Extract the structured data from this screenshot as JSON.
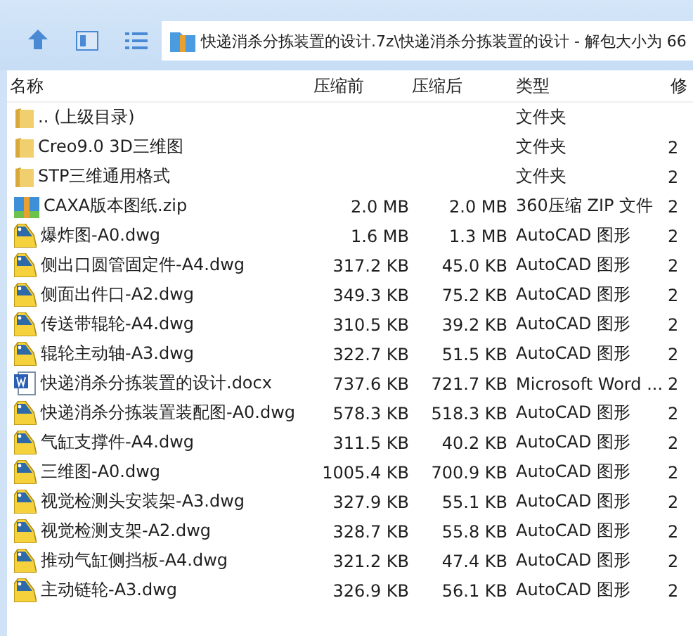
{
  "address": "快递消杀分拣装置的设计.7z\\快递消杀分拣装置的设计 - 解包大小为 66",
  "columns": [
    {
      "label": "名称"
    },
    {
      "label": "压缩前"
    },
    {
      "label": "压缩后"
    },
    {
      "label": "类型"
    },
    {
      "label": "修"
    }
  ],
  "rows": [
    {
      "kind": "folder",
      "name": ".. (上级目录)",
      "size": "",
      "packed": "",
      "type": "文件夹",
      "modified": ""
    },
    {
      "kind": "folder",
      "name": "Creo9.0 3D三维图",
      "size": "",
      "packed": "",
      "type": "文件夹",
      "modified": "2"
    },
    {
      "kind": "folder",
      "name": "STP三维通用格式",
      "size": "",
      "packed": "",
      "type": "文件夹",
      "modified": "2"
    },
    {
      "kind": "zip",
      "name": "CAXA版本图纸.zip",
      "size": "2.0 MB",
      "packed": "2.0 MB",
      "type": "360压缩 ZIP 文件",
      "modified": "2"
    },
    {
      "kind": "dwg",
      "name": "爆炸图-A0.dwg",
      "size": "1.6 MB",
      "packed": "1.3 MB",
      "type": "AutoCAD 图形",
      "modified": "2"
    },
    {
      "kind": "dwg",
      "name": "侧出口圆管固定件-A4.dwg",
      "size": "317.2 KB",
      "packed": "45.0 KB",
      "type": "AutoCAD 图形",
      "modified": "2"
    },
    {
      "kind": "dwg",
      "name": "侧面出件口-A2.dwg",
      "size": "349.3 KB",
      "packed": "75.2 KB",
      "type": "AutoCAD 图形",
      "modified": "2"
    },
    {
      "kind": "dwg",
      "name": "传送带辊轮-A4.dwg",
      "size": "310.5 KB",
      "packed": "39.2 KB",
      "type": "AutoCAD 图形",
      "modified": "2"
    },
    {
      "kind": "dwg",
      "name": "辊轮主动轴-A3.dwg",
      "size": "322.7 KB",
      "packed": "51.5 KB",
      "type": "AutoCAD 图形",
      "modified": "2"
    },
    {
      "kind": "docx",
      "name": "快递消杀分拣装置的设计.docx",
      "size": "737.6 KB",
      "packed": "721.7 KB",
      "type": "Microsoft Word ...",
      "modified": "2"
    },
    {
      "kind": "dwg",
      "name": "快递消杀分拣装置装配图-A0.dwg",
      "size": "578.3 KB",
      "packed": "518.3 KB",
      "type": "AutoCAD 图形",
      "modified": "2"
    },
    {
      "kind": "dwg",
      "name": "气缸支撑件-A4.dwg",
      "size": "311.5 KB",
      "packed": "40.2 KB",
      "type": "AutoCAD 图形",
      "modified": "2"
    },
    {
      "kind": "dwg",
      "name": "三维图-A0.dwg",
      "size": "1005.4 KB",
      "packed": "700.9 KB",
      "type": "AutoCAD 图形",
      "modified": "2"
    },
    {
      "kind": "dwg",
      "name": "视觉检测头安装架-A3.dwg",
      "size": "327.9 KB",
      "packed": "55.1 KB",
      "type": "AutoCAD 图形",
      "modified": "2"
    },
    {
      "kind": "dwg",
      "name": "视觉检测支架-A2.dwg",
      "size": "328.7 KB",
      "packed": "55.8 KB",
      "type": "AutoCAD 图形",
      "modified": "2"
    },
    {
      "kind": "dwg",
      "name": "推动气缸侧挡板-A4.dwg",
      "size": "321.2 KB",
      "packed": "47.4 KB",
      "type": "AutoCAD 图形",
      "modified": "2"
    },
    {
      "kind": "dwg",
      "name": "主动链轮-A3.dwg",
      "size": "326.9 KB",
      "packed": "56.1 KB",
      "type": "AutoCAD 图形",
      "modified": "2"
    }
  ]
}
